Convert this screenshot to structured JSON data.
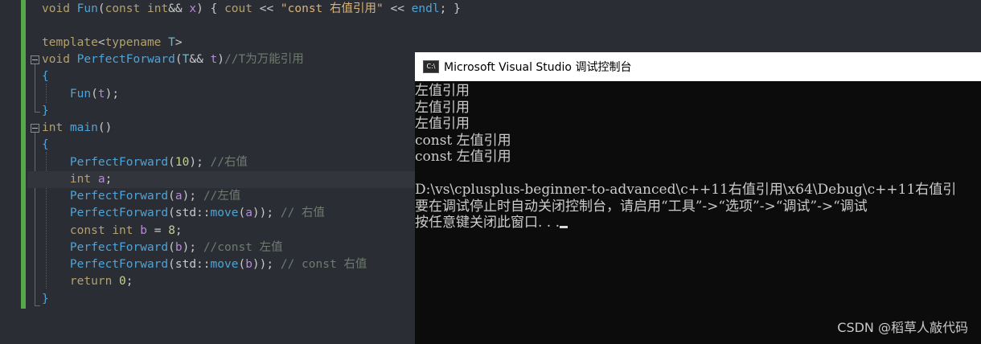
{
  "editor": {
    "lines": [
      [
        "void Fun(const int&& x) { cout << \"const 右值引用\" << endl; }"
      ],
      [
        "template<typename T>"
      ],
      [
        "void PerfectForward(T&& t)//T为万能引用"
      ],
      [
        "{"
      ],
      [
        "Fun(t);"
      ],
      [
        "}"
      ],
      [
        "int main()"
      ],
      [
        "{"
      ],
      [
        "PerfectForward(10); //右值"
      ],
      [
        "int a;"
      ],
      [
        "PerfectForward(a); //左值"
      ],
      [
        "PerfectForward(std::move(a)); // 右值"
      ],
      [
        "const int b = 8;"
      ],
      [
        "PerfectForward(b); //const 左值"
      ],
      [
        "PerfectForward(std::move(b)); // const 右值"
      ],
      [
        "return 0;"
      ],
      [
        "}"
      ]
    ]
  },
  "console": {
    "icon_label": "C:\\",
    "title": "Microsoft Visual Studio 调试控制台",
    "output": [
      "左值引用",
      "左值引用",
      "左值引用",
      "const 左值引用",
      "const 左值引用",
      "",
      "D:\\vs\\cplusplus-beginner-to-advanced\\c++11右值引用\\x64\\Debug\\c++11右值引",
      "要在调试停止时自动关闭控制台，请启用“工具”->“选项”->“调试”->“调试",
      "按任意键关闭此窗口. . ."
    ]
  },
  "watermark": "CSDN @稻草人敲代码"
}
